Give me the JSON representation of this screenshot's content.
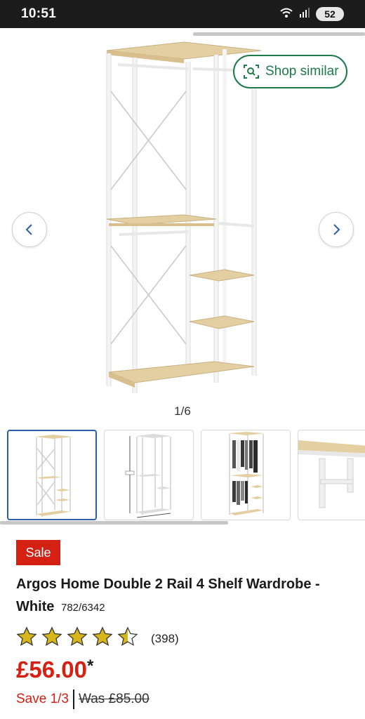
{
  "status_bar": {
    "time": "10:51",
    "battery": "52",
    "icons": [
      "wifi-icon",
      "signal-icon",
      "battery-icon"
    ]
  },
  "gallery": {
    "shop_similar_label": "Shop similar",
    "counter": "1/6",
    "thumbnails": [
      {
        "name": "thumb-front-view",
        "active": true
      },
      {
        "name": "thumb-dimensions",
        "active": false
      },
      {
        "name": "thumb-with-clothes",
        "active": false
      },
      {
        "name": "thumb-detail",
        "active": false
      }
    ]
  },
  "product": {
    "badge": "Sale",
    "title": "Argos Home Double 2 Rail 4 Shelf Wardrobe - White",
    "sku": "782/6342",
    "rating": 4.5,
    "review_count": "(398)",
    "price": "£56.00",
    "price_marker": "*",
    "save": "Save 1/3",
    "was_price": "Was £85.00"
  },
  "colors": {
    "sale_red": "#d42114",
    "accent_green": "#1d7a4a",
    "active_thumb_blue": "#2c5da8",
    "star_gold": "#d7b61c"
  }
}
